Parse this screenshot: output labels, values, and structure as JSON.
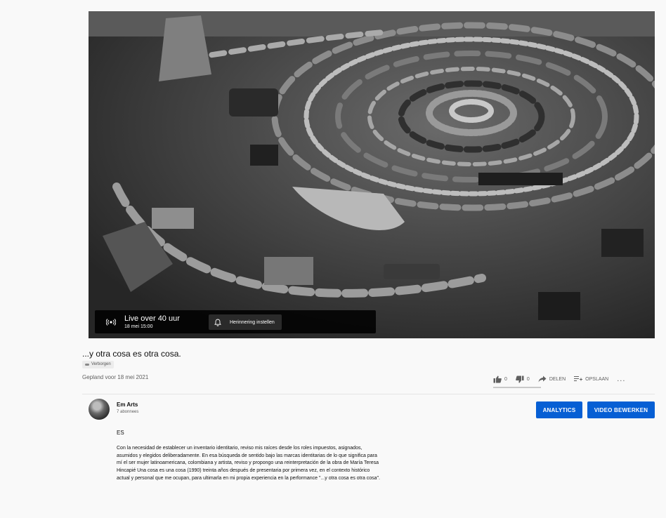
{
  "player": {
    "live_status": "Live over 40 uur",
    "live_datetime": "18 mei 15:00",
    "reminder_label": "Herinnering instellen",
    "live_icon": "broadcast-icon",
    "reminder_icon": "bell-icon"
  },
  "video": {
    "title": "...y otra cosa es otra cosa.",
    "visibility": "Verborgen",
    "scheduled": "Gepland voor 18 mei 2021"
  },
  "actions": {
    "like_count": "0",
    "dislike_count": "0",
    "share_label": "DELEN",
    "save_label": "OPSLAAN",
    "more_label": "..."
  },
  "channel": {
    "name": "Em Arts",
    "subscribers": "7 abonnees"
  },
  "buttons": {
    "analytics": "ANALYTICS",
    "edit": "VIDEO BEWERKEN"
  },
  "description": {
    "language": "ES",
    "text": "Con la necesidad de establecer un inventario identitario, reviso mis raíces desde los roles impuestos, asignados, asumidos y elegidos deliberadamente. En esa búsqueda de sentido bajo las marcas identitarias de lo que significa para mí el ser mujer latinoamericana, colombiana y artista, reviso y propongo una reinterpretación de la obra de María Teresa Hincapié Una cosa es una cosa (1990) treinta años después de presentaria por primera vez, en el contexto histórico actual y personal que me ocupan, para ultimarla en mi propia experiencia en la performance \"...y otra cosa es otra cosa\"."
  },
  "colors": {
    "accent": "#065fd4",
    "background": "#f9f9f9",
    "overlay": "#000000"
  }
}
